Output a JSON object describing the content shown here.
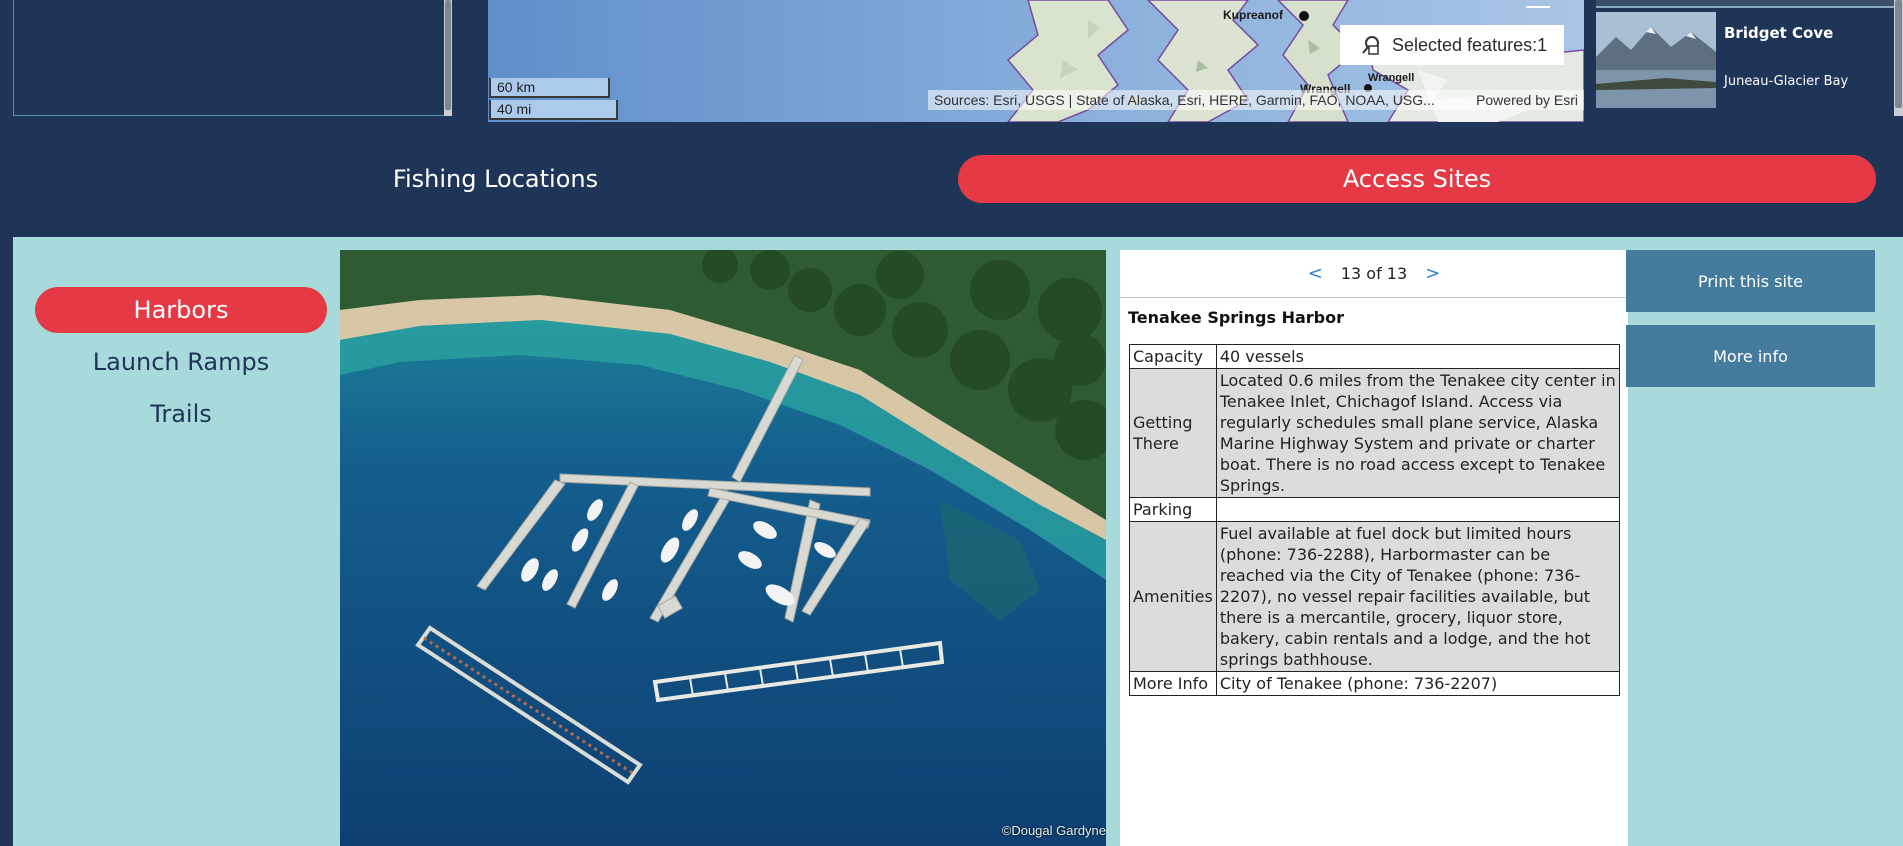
{
  "map": {
    "places": {
      "kupreanof": "Kupreanof",
      "wrangell": "Wrangell",
      "wrangell_label": "Wrangell"
    },
    "selected_features": "Selected features:1",
    "scale_km": "60 km",
    "scale_mi": "40 mi",
    "attribution": "Sources: Esri, USGS | State of Alaska, Esri, HERE, Garmin, FAO, NOAA, USG...",
    "powered_by": "Powered by Esri",
    "colors": {
      "water": "#6e9ad0",
      "land": "#d8e3cf",
      "border": "#7b4aa0"
    }
  },
  "gallery": {
    "card": {
      "title": "Bridget Cove",
      "subtitle": "Juneau-Glacier Bay"
    }
  },
  "tabs": {
    "fishing": "Fishing Locations",
    "access": "Access Sites",
    "active": "access"
  },
  "nav": {
    "items": [
      {
        "label": "Harbors",
        "active": true
      },
      {
        "label": "Launch Ramps",
        "active": false
      },
      {
        "label": "Trails",
        "active": false
      }
    ]
  },
  "photo": {
    "credit": "©Dougal Gardyne"
  },
  "popup": {
    "pager": {
      "prev": "<",
      "text": "13 of 13",
      "next": ">"
    },
    "title": "Tenakee Springs Harbor",
    "rows": [
      {
        "key": "Capacity",
        "value": "40 vessels"
      },
      {
        "key": "Getting There",
        "value": "Located 0.6 miles from the Tenakee city center in Tenakee Inlet, Chichagof Island. Access via regularly schedules small plane service, Alaska Marine Highway System and private or charter boat. There is no road access except to Tenakee Springs."
      },
      {
        "key": "Parking",
        "value": ""
      },
      {
        "key": "Amenities",
        "value": "Fuel available at fuel dock but limited hours (phone: 736-2288), Harbormaster can be reached via the City of Tenakee (phone: 736-2207), no vessel repair facilities available, but there is a mercantile, grocery, liquor store, bakery, cabin rentals and a lodge, and the hot springs bathhouse."
      },
      {
        "key": "More Info",
        "value": "City of Tenakee (phone: 736-2207)"
      }
    ]
  },
  "actions": {
    "print": "Print this site",
    "more_info": "More info"
  },
  "colors": {
    "navy": "#1e3558",
    "accent_red": "#e63946",
    "panel_teal": "#a8dadc",
    "button_blue": "#457b9d"
  }
}
